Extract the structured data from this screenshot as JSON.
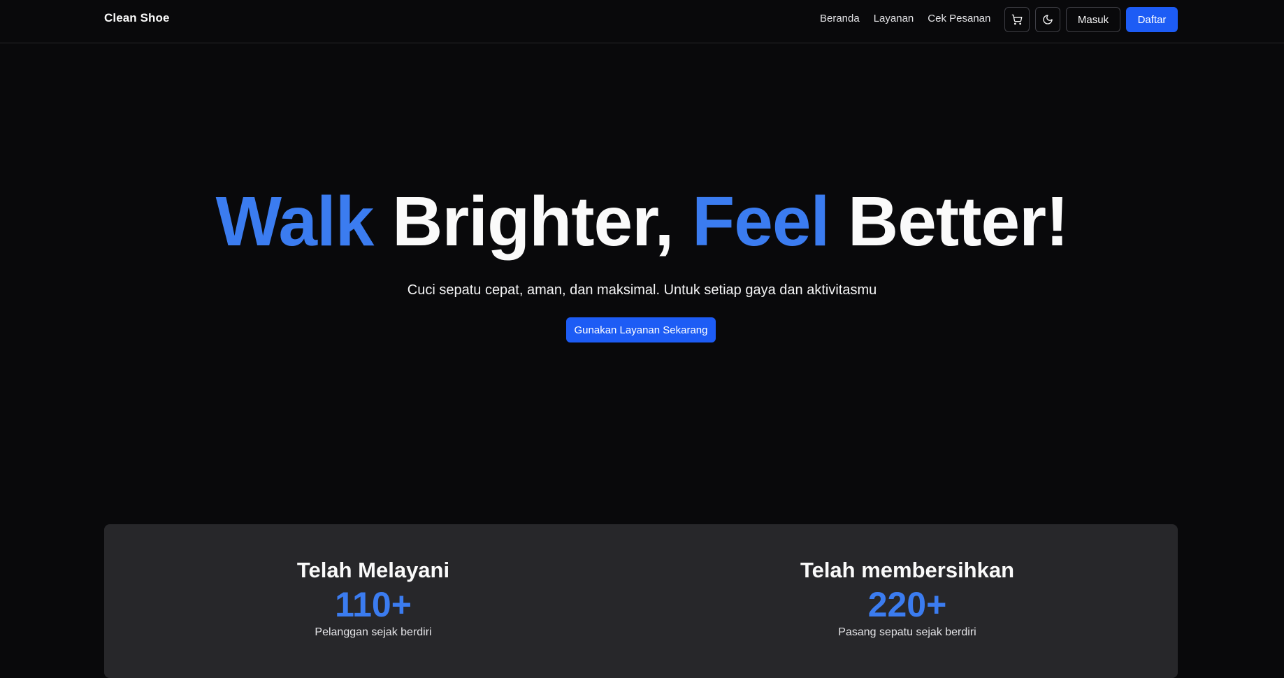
{
  "header": {
    "brand": "Clean Shoe",
    "nav": [
      {
        "label": "Beranda"
      },
      {
        "label": "Layanan"
      },
      {
        "label": "Cek Pesanan"
      }
    ],
    "cart_icon": "shopping-cart-icon",
    "theme_icon": "moon-icon",
    "login_label": "Masuk",
    "register_label": "Daftar"
  },
  "hero": {
    "title_words": [
      "Walk",
      "Brighter,",
      "Feel",
      "Better!"
    ],
    "subtitle": "Cuci sepatu cepat, aman, dan maksimal. Untuk setiap gaya dan aktivitasmu",
    "cta_label": "Gunakan Layanan Sekarang"
  },
  "stats": [
    {
      "label": "Telah Melayani",
      "value": "110+",
      "desc": "Pelanggan sejak berdiri"
    },
    {
      "label": "Telah membersihkan",
      "value": "220+",
      "desc": "Pasang sepatu sejak berdiri"
    }
  ],
  "colors": {
    "background": "#09090b",
    "accent": "#3b7cf0",
    "primary_button": "#1d5cf5",
    "card": "#27272a"
  }
}
